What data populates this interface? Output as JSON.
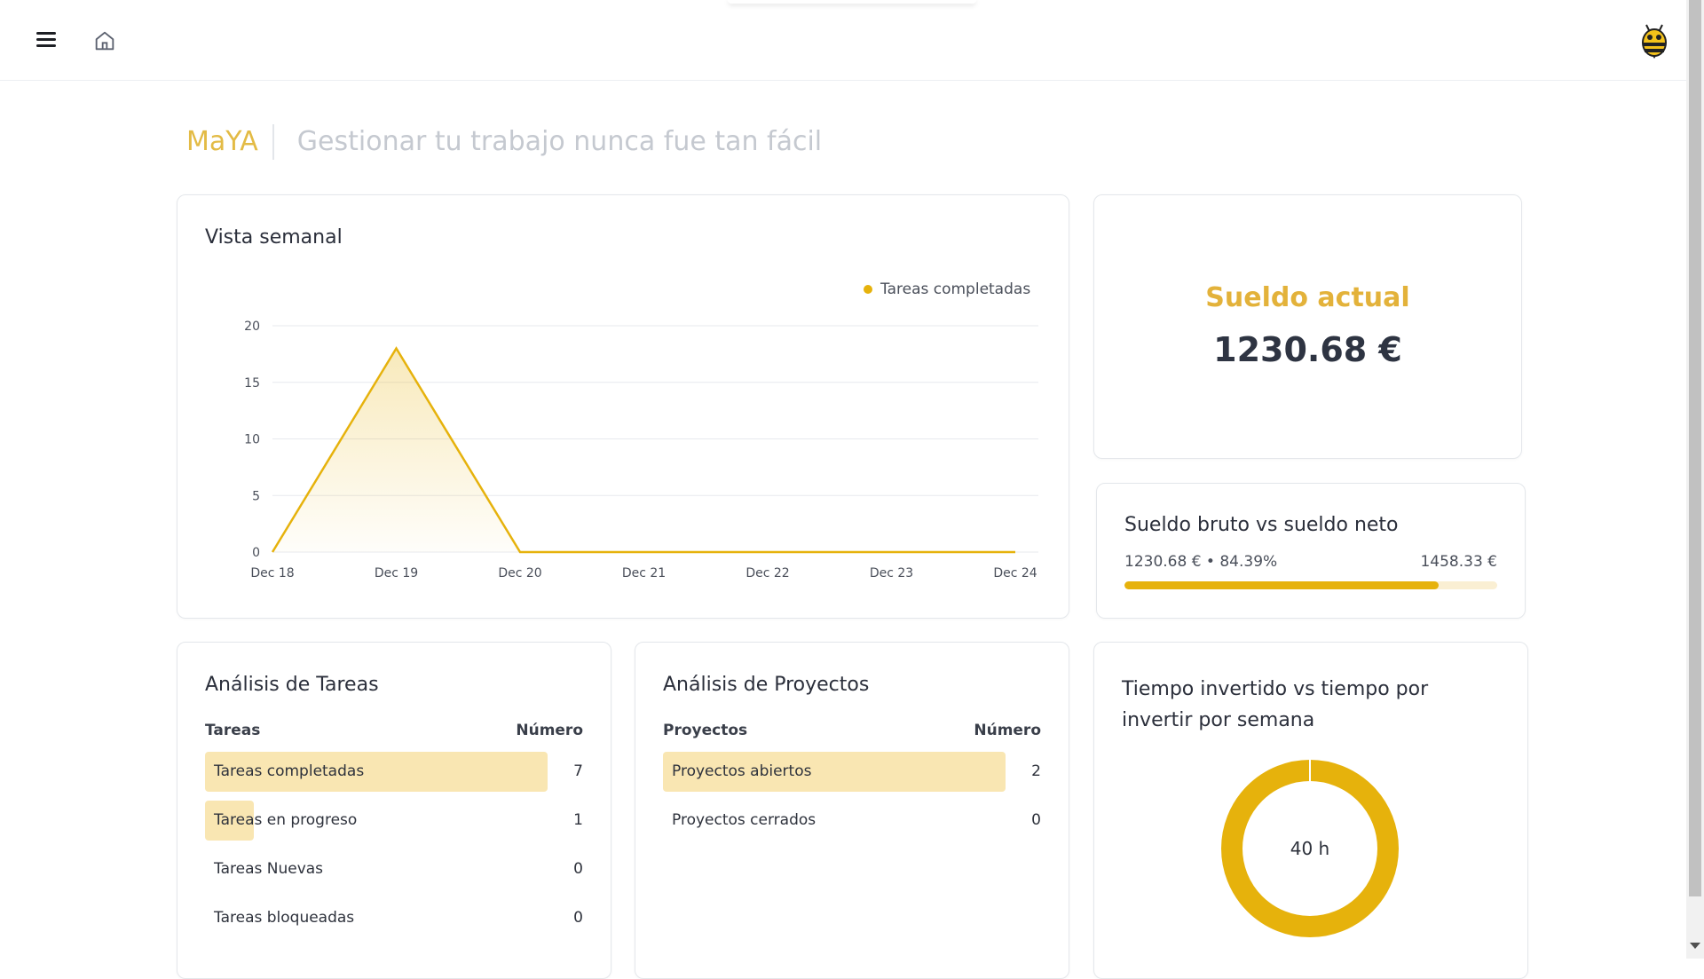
{
  "header": {
    "menu_icon": "hamburger-menu-icon",
    "home_icon": "home-icon",
    "avatar_icon": "bee-avatar-icon"
  },
  "brand": {
    "name": "MaYA",
    "tagline": "Gestionar tu trabajo nunca fue tan fácil"
  },
  "weekly": {
    "title": "Vista semanal"
  },
  "chart_data": {
    "type": "area",
    "title": "Vista semanal",
    "x": [
      "Dec 18",
      "Dec 19",
      "Dec 20",
      "Dec 21",
      "Dec 22",
      "Dec 23",
      "Dec 24"
    ],
    "series": [
      {
        "name": "Tareas completadas",
        "values": [
          0,
          18,
          0,
          0,
          0,
          0,
          0
        ]
      }
    ],
    "yticks": [
      0,
      5,
      10,
      15,
      20
    ],
    "ylim": [
      0,
      20
    ],
    "grid": true,
    "legend_position": "top-right",
    "color": "#e6b20c"
  },
  "salary": {
    "label": "Sueldo actual",
    "value": "1230.68 €"
  },
  "gross_net": {
    "title": "Sueldo bruto vs sueldo neto",
    "left_text": "1230.68 € • 84.39%",
    "right_text": "1458.33 €",
    "progress_fraction": 0.8439
  },
  "tasks": {
    "title": "Análisis de Tareas",
    "col_label": "Tareas",
    "col_number": "Número",
    "rows": [
      {
        "label": "Tareas completadas",
        "value": "7",
        "fraction": 1.0
      },
      {
        "label": "Tareas en progreso",
        "value": "1",
        "fraction": 0.1429
      },
      {
        "label": "Tareas Nuevas",
        "value": "0",
        "fraction": 0
      },
      {
        "label": "Tareas bloqueadas",
        "value": "0",
        "fraction": 0
      }
    ]
  },
  "projects": {
    "title": "Análisis de Proyectos",
    "col_label": "Proyectos",
    "col_number": "Número",
    "rows": [
      {
        "label": "Proyectos abiertos",
        "value": "2",
        "fraction": 1.0
      },
      {
        "label": "Proyectos cerrados",
        "value": "0",
        "fraction": 0
      }
    ]
  },
  "time": {
    "title": "Tiempo invertido vs tiempo por invertir por semana",
    "center_label": "40 h",
    "color": "#e6b20c"
  }
}
